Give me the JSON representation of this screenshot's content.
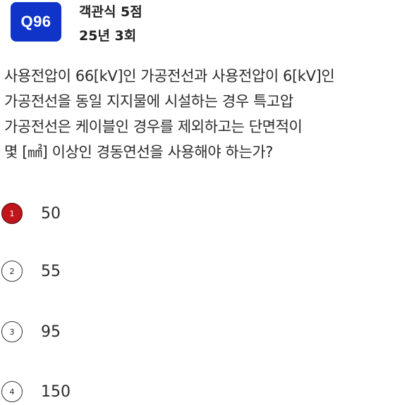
{
  "badge": {
    "label": "Q96"
  },
  "meta": {
    "category": "객관식 5점",
    "session": "25년 3회"
  },
  "question": {
    "lines": [
      "사용전압이 66[kV]인 가공전선과 사용전압이 6[kV]인",
      "가공전선을 동일 지지물에 시설하는 경우 특고압",
      "가공전선은 케이블인 경우를 제외하고는 단면적이",
      "몇 [㎟] 이상인 경동연선을 사용해야 하는가?"
    ]
  },
  "choices": [
    {
      "number": "1",
      "text": "50",
      "selected": true
    },
    {
      "number": "2",
      "text": "55",
      "selected": false
    },
    {
      "number": "3",
      "text": "95",
      "selected": false
    },
    {
      "number": "4",
      "text": "150",
      "selected": false
    }
  ],
  "colors": {
    "badge_bg": "#1034c8",
    "selected_marker": "#c0151b"
  }
}
